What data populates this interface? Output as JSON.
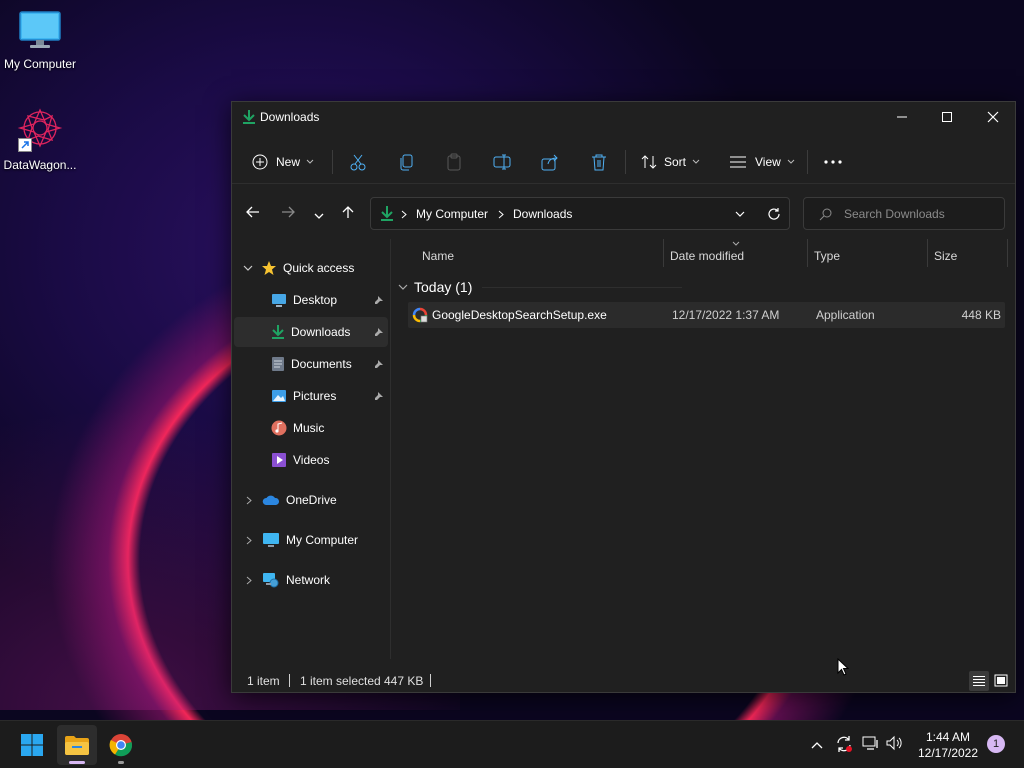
{
  "desktop": {
    "icons": [
      {
        "label": "My Computer"
      },
      {
        "label": "DataWagon..."
      }
    ]
  },
  "window": {
    "title": "Downloads",
    "controls": {
      "minimize": "minimize",
      "maximize": "maximize",
      "close": "close"
    }
  },
  "toolbar": {
    "new_label": "New",
    "sort_label": "Sort",
    "view_label": "View"
  },
  "address": {
    "crumbs": [
      "My Computer",
      "Downloads"
    ]
  },
  "search": {
    "placeholder": "Search Downloads"
  },
  "sidebar": {
    "quick_access": "Quick access",
    "items": [
      {
        "label": "Desktop",
        "pinned": true
      },
      {
        "label": "Downloads",
        "pinned": true,
        "selected": true
      },
      {
        "label": "Documents",
        "pinned": true
      },
      {
        "label": "Pictures",
        "pinned": true
      },
      {
        "label": "Music",
        "pinned": false
      },
      {
        "label": "Videos",
        "pinned": false
      }
    ],
    "roots": [
      "OneDrive",
      "My Computer",
      "Network"
    ]
  },
  "columns": [
    "Name",
    "Date modified",
    "Type",
    "Size"
  ],
  "groups": [
    {
      "label": "Today (1)",
      "files": [
        {
          "name": "GoogleDesktopSearchSetup.exe",
          "date": "12/17/2022 1:37 AM",
          "type": "Application",
          "size": "448 KB"
        }
      ]
    }
  ],
  "status": {
    "count": "1 item",
    "selection": "1 item selected",
    "selection_size": "447 KB"
  },
  "taskbar": {
    "time": "1:44 AM",
    "date": "12/17/2022",
    "notification_count": "1"
  },
  "colors": {
    "accent": "#1fa463",
    "window_bg": "#202020",
    "folder_yellow": "#f5c342",
    "start_blue": "#2aa7f0"
  }
}
